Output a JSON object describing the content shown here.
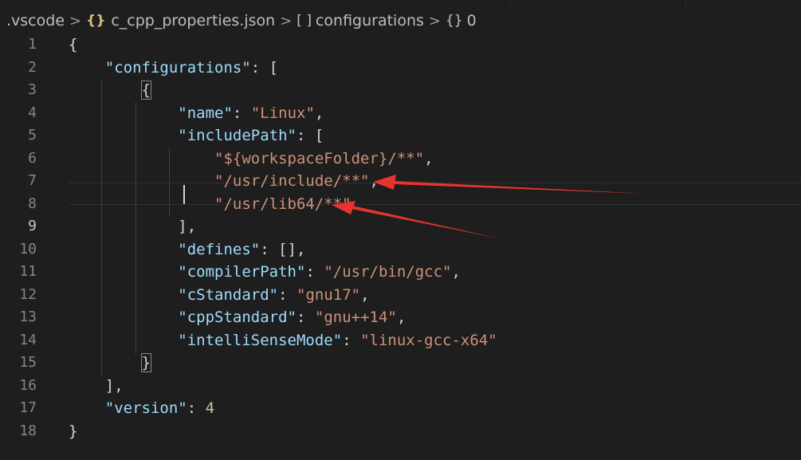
{
  "breadcrumb": {
    "folder": ".vscode",
    "file": "c_cpp_properties.json",
    "file_icon": "{}",
    "array_icon": "[ ]",
    "array": "configurations",
    "object_icon": "{}",
    "object": "0",
    "separator": ">"
  },
  "editor": {
    "current_line": 9,
    "lines": [
      {
        "num": "1",
        "parts": [
          {
            "t": "{",
            "c": "p"
          }
        ]
      },
      {
        "num": "2",
        "parts": [
          {
            "t": "    ",
            "c": "p"
          },
          {
            "t": "\"configurations\"",
            "c": "k"
          },
          {
            "t": ": [",
            "c": "p"
          }
        ]
      },
      {
        "num": "3",
        "parts": [
          {
            "t": "        ",
            "c": "p"
          },
          {
            "t": "{",
            "c": "p bm"
          }
        ]
      },
      {
        "num": "4",
        "parts": [
          {
            "t": "            ",
            "c": "p"
          },
          {
            "t": "\"name\"",
            "c": "k"
          },
          {
            "t": ": ",
            "c": "p"
          },
          {
            "t": "\"Linux\"",
            "c": "s"
          },
          {
            "t": ",",
            "c": "p"
          }
        ]
      },
      {
        "num": "5",
        "parts": [
          {
            "t": "            ",
            "c": "p"
          },
          {
            "t": "\"includePath\"",
            "c": "k"
          },
          {
            "t": ": [",
            "c": "p"
          }
        ]
      },
      {
        "num": "6",
        "parts": [
          {
            "t": "                ",
            "c": "p"
          },
          {
            "t": "\"${workspaceFolder}/**\"",
            "c": "s"
          },
          {
            "t": ",",
            "c": "p"
          }
        ]
      },
      {
        "num": "7",
        "parts": [
          {
            "t": "                ",
            "c": "p"
          },
          {
            "t": "\"/usr/include/**\"",
            "c": "s"
          },
          {
            "t": ",",
            "c": "p"
          }
        ]
      },
      {
        "num": "8",
        "parts": [
          {
            "t": "                ",
            "c": "p"
          },
          {
            "t": "\"/usr/lib64/**\"",
            "c": "s"
          }
        ]
      },
      {
        "num": "9",
        "parts": [
          {
            "t": "            ",
            "c": "p"
          },
          {
            "t": "],",
            "c": "p"
          }
        ]
      },
      {
        "num": "10",
        "parts": [
          {
            "t": "            ",
            "c": "p"
          },
          {
            "t": "\"defines\"",
            "c": "k"
          },
          {
            "t": ": [],",
            "c": "p"
          }
        ]
      },
      {
        "num": "11",
        "parts": [
          {
            "t": "            ",
            "c": "p"
          },
          {
            "t": "\"compilerPath\"",
            "c": "k"
          },
          {
            "t": ": ",
            "c": "p"
          },
          {
            "t": "\"/usr/bin/gcc\"",
            "c": "s"
          },
          {
            "t": ",",
            "c": "p"
          }
        ]
      },
      {
        "num": "12",
        "parts": [
          {
            "t": "            ",
            "c": "p"
          },
          {
            "t": "\"cStandard\"",
            "c": "k"
          },
          {
            "t": ": ",
            "c": "p"
          },
          {
            "t": "\"gnu17\"",
            "c": "s"
          },
          {
            "t": ",",
            "c": "p"
          }
        ]
      },
      {
        "num": "13",
        "parts": [
          {
            "t": "            ",
            "c": "p"
          },
          {
            "t": "\"cppStandard\"",
            "c": "k"
          },
          {
            "t": ": ",
            "c": "p"
          },
          {
            "t": "\"gnu++14\"",
            "c": "s"
          },
          {
            "t": ",",
            "c": "p"
          }
        ]
      },
      {
        "num": "14",
        "parts": [
          {
            "t": "            ",
            "c": "p"
          },
          {
            "t": "\"intelliSenseMode\"",
            "c": "k"
          },
          {
            "t": ": ",
            "c": "p"
          },
          {
            "t": "\"linux-gcc-x64\"",
            "c": "s"
          }
        ]
      },
      {
        "num": "15",
        "parts": [
          {
            "t": "        ",
            "c": "p"
          },
          {
            "t": "}",
            "c": "p bm"
          }
        ]
      },
      {
        "num": "16",
        "parts": [
          {
            "t": "    ",
            "c": "p"
          },
          {
            "t": "],",
            "c": "p"
          }
        ]
      },
      {
        "num": "17",
        "parts": [
          {
            "t": "    ",
            "c": "p"
          },
          {
            "t": "\"version\"",
            "c": "k"
          },
          {
            "t": ": ",
            "c": "p"
          },
          {
            "t": "4",
            "c": "n"
          }
        ]
      },
      {
        "num": "18",
        "parts": [
          {
            "t": "}",
            "c": "p"
          }
        ]
      }
    ]
  },
  "colors": {
    "background": "#1e1e1e",
    "key": "#9cdcfe",
    "string": "#ce9178",
    "number": "#b5cea8",
    "annotation_arrow": "#e8342e"
  }
}
